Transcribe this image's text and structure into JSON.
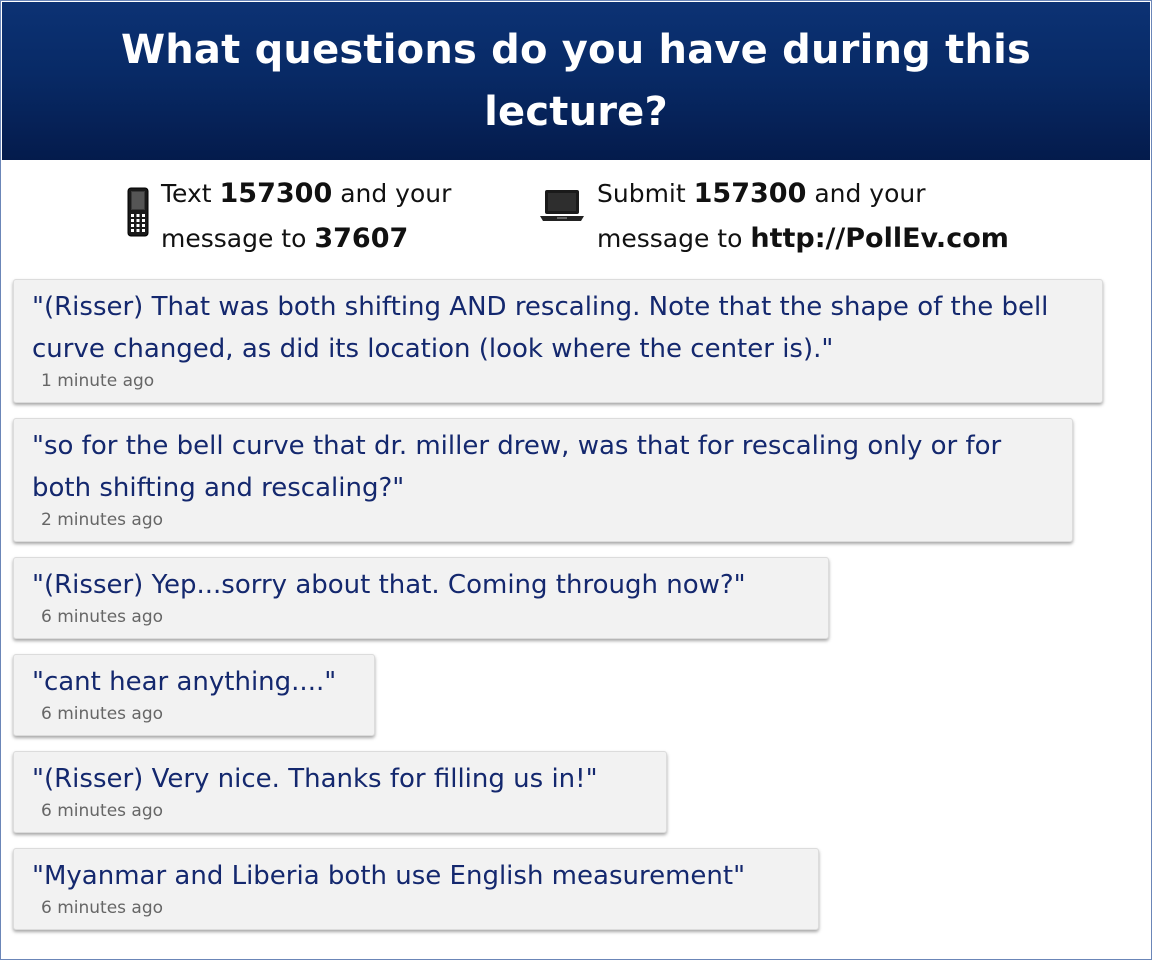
{
  "header": {
    "title": "What questions do you have during this lecture?"
  },
  "instructions": {
    "text": {
      "icon": "phone-icon",
      "prefix": "Text ",
      "code": "157300",
      "middle": " and your",
      "line2_prefix": "message to ",
      "number": "37607"
    },
    "web": {
      "icon": "laptop-icon",
      "prefix": "Submit ",
      "code": "157300",
      "middle": " and your",
      "line2_prefix": "message to ",
      "url": "http://PollEv.com"
    }
  },
  "feed": {
    "items": [
      {
        "message": "\"(Risser) That was both shifting AND rescaling. Note that the shape of the bell curve changed, as did its location (look where the center is).\"",
        "time": "1 minute ago"
      },
      {
        "message": "\"so for the bell curve that dr. miller drew, was that for rescaling only or for both shifting and rescaling?\"",
        "time": "2 minutes ago"
      },
      {
        "message": "\"(Risser) Yep...sorry about that. Coming through now?\"",
        "time": "6 minutes ago"
      },
      {
        "message": "\"cant hear anything....\"",
        "time": "6 minutes ago"
      },
      {
        "message": "\"(Risser) Very nice. Thanks for filling us in!\"",
        "time": "6 minutes ago"
      },
      {
        "message": "\"Myanmar and Liberia both use English measurement\"",
        "time": "6 minutes ago"
      }
    ]
  }
}
